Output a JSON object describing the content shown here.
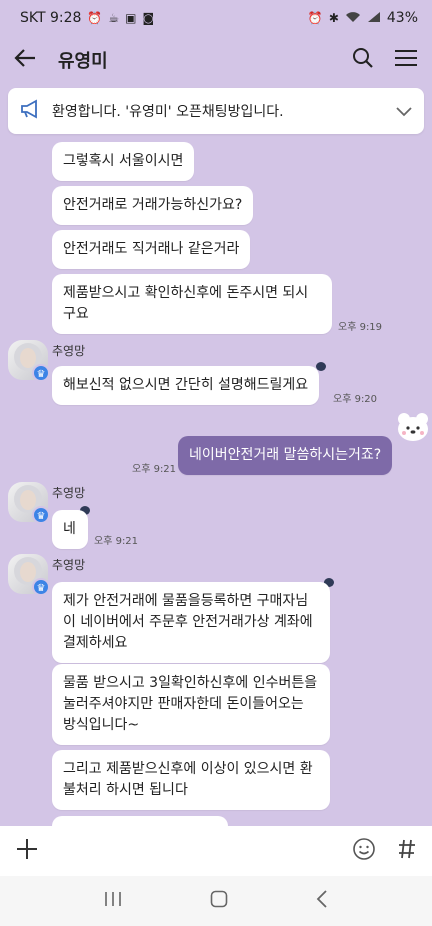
{
  "status_bar": {
    "carrier_time": "SKT 9:28",
    "battery": "43%"
  },
  "header": {
    "title": "유영미"
  },
  "notice": {
    "text": "환영합니다. '유영미' 오픈채팅방입니다."
  },
  "sender_name": "추영망",
  "messages": {
    "m1": "그렇혹시 서울이시면",
    "m2": "안전거래로 거래가능하신가요?",
    "m3": "안전거래도 직거래나 같은거라",
    "m4": "제품받으시고 확인하신후에 돈주시면 되시구요",
    "m5": "해보신적 없으시면 간단히 설명해드릴게요",
    "m6": "네이버안전거래 말씀하시는거죠?",
    "m7": "네",
    "m8": "제가 안전거래에 물품을등록하면 구매자님이 네이버에서 주문후 안전거래가상 계좌에 결제하세요",
    "m9": "물품 받으시고 3일확인하신후에 인수버튼을 눌러주셔야지만 판매자한데 돈이들어오는 방식입니다~",
    "m10": "그리고 제품받으신후에 이상이 있으시면 환불처리 하시면 됩니다"
  },
  "times": {
    "t1": "오후 9:19",
    "t2": "오후 9:20",
    "t3": "오후 9:21",
    "t4": "오후 9:21"
  },
  "input_bar": {
    "plus": "+",
    "hash": "#"
  },
  "colors": {
    "background": "#d3c5e6",
    "my_bubble": "#7e6aa8",
    "badge": "#3d84e6"
  }
}
